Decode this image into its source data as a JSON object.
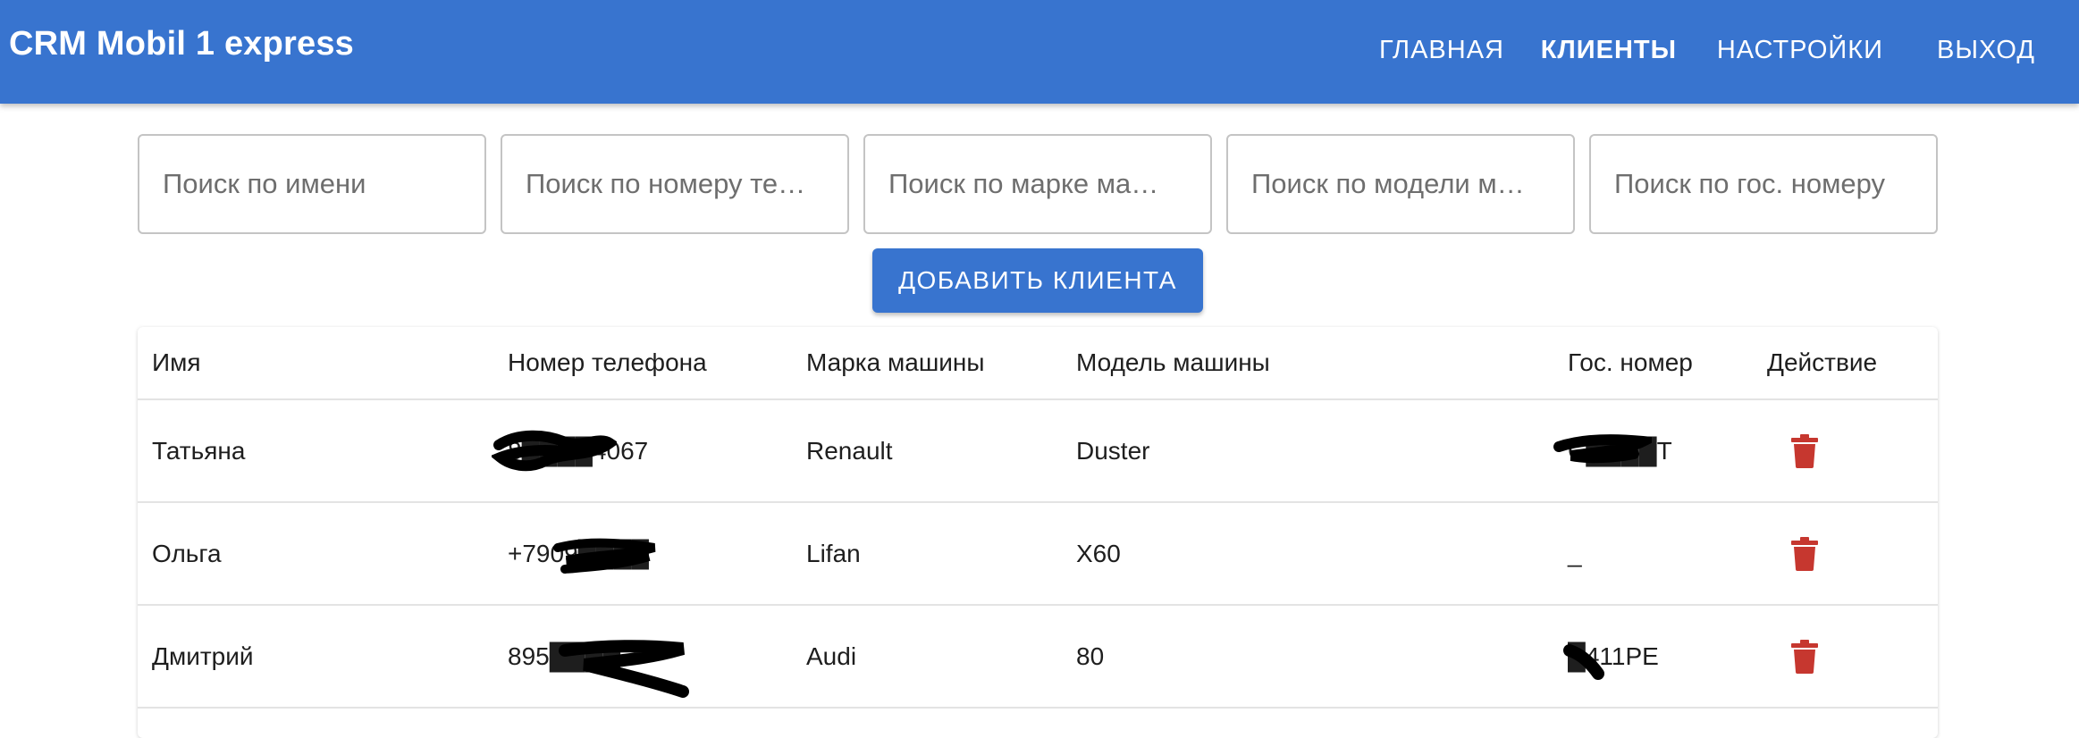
{
  "app": {
    "title": "CRM Mobil 1 express"
  },
  "nav": {
    "items": [
      {
        "label": "ГЛАВНАЯ",
        "active": false
      },
      {
        "label": "КЛИЕНТЫ",
        "active": true
      },
      {
        "label": "НАСТРОЙКИ",
        "active": false
      },
      {
        "label": "ВЫХОД",
        "active": false
      }
    ]
  },
  "search": {
    "name_placeholder": "Поиск по имени",
    "phone_placeholder": "Поиск по номеру те…",
    "brand_placeholder": "Поиск по марке ма…",
    "model_placeholder": "Поиск по модели м…",
    "plate_placeholder": "Поиск по гос. номеру"
  },
  "actions": {
    "add_client_label": "ДОБАВИТЬ КЛИЕНТА"
  },
  "table": {
    "headers": [
      "Имя",
      "Номер телефона",
      "Марка машины",
      "Модель машины",
      "Гос. номер",
      "Действие"
    ],
    "rows": [
      {
        "name": "Татьяна",
        "phone": "8████4067",
        "brand": "Renault",
        "model": "Duster",
        "plate": "С████Т"
      },
      {
        "name": "Ольга",
        "phone": "+7909████",
        "brand": "Lifan",
        "model": "X60",
        "plate": "_"
      },
      {
        "name": "Дмитрий",
        "phone": "895████",
        "brand": "Audi",
        "model": "80",
        "plate": "█411РЕ"
      }
    ],
    "action_icon": "trash-icon",
    "action_color": "#c6372f"
  },
  "colors": {
    "primary": "#3874cf",
    "danger": "#c6372f"
  }
}
